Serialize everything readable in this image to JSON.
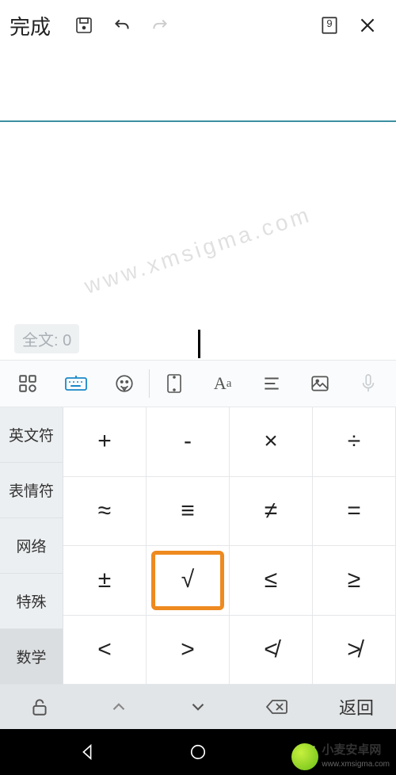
{
  "topbar": {
    "done_label": "完成",
    "page_badge": "9"
  },
  "canvas": {
    "char_count_label": "全文: 0"
  },
  "keyboard": {
    "categories": [
      "英文符",
      "表情符",
      "网络",
      "特殊",
      "数学"
    ],
    "active_category_index": 4,
    "grid": [
      [
        "+",
        "-",
        "×",
        "÷"
      ],
      [
        "≈",
        "≡",
        "≠",
        "="
      ],
      [
        "±",
        "√",
        "≤",
        "≥"
      ],
      [
        "<",
        ">",
        "≮",
        "≯"
      ]
    ],
    "highlight": {
      "row": 2,
      "col": 1
    }
  },
  "bottombar": {
    "return_label": "返回"
  },
  "watermark": {
    "diag": "www.xmsigma.com",
    "brand_cn": "小麦安卓网",
    "brand_url": "www.xmsigma.com"
  }
}
